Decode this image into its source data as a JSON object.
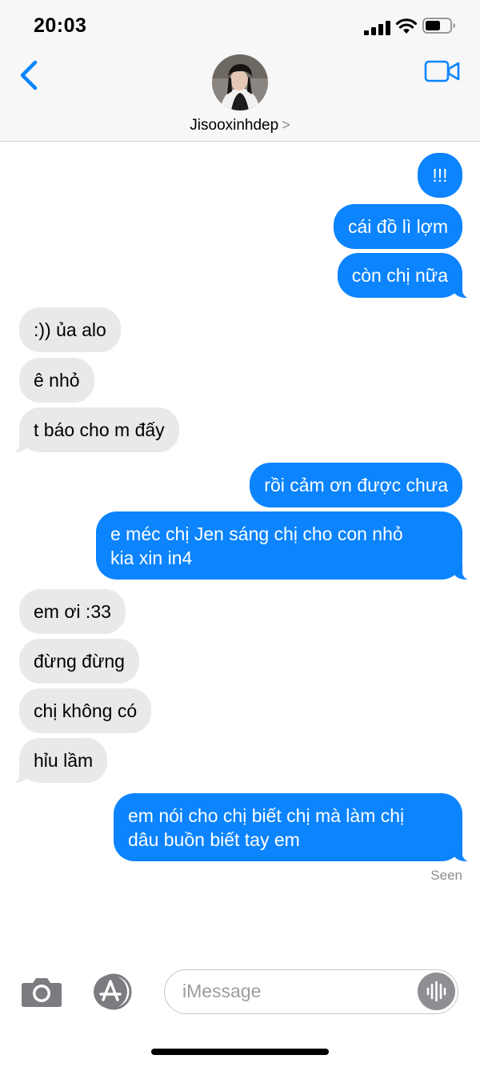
{
  "status": {
    "time": "20:03"
  },
  "header": {
    "contact_name": "Jisooxinhdep",
    "chevron": ">"
  },
  "messages": [
    {
      "dir": "out",
      "text": "!!!"
    },
    {
      "dir": "out",
      "text": "cái đồ lì lợm"
    },
    {
      "dir": "out",
      "text": "còn chị nữa"
    },
    {
      "dir": "in",
      "text": ":)) ủa alo"
    },
    {
      "dir": "in",
      "text": "ê nhỏ"
    },
    {
      "dir": "in",
      "text": "t báo cho m đấy"
    },
    {
      "dir": "out",
      "text": "rồi cảm ơn được chưa"
    },
    {
      "dir": "out",
      "text_lines": [
        "e méc chị Jen sáng chị cho con nhỏ",
        "kia xin in4"
      ]
    },
    {
      "dir": "in",
      "text": "em ơi :33"
    },
    {
      "dir": "in",
      "text": "đừng đừng"
    },
    {
      "dir": "in",
      "text": "chị không có"
    },
    {
      "dir": "in",
      "text": "hỉu lầm"
    },
    {
      "dir": "out",
      "text_lines": [
        "em nói cho chị biết chị mà làm chị",
        "dâu buồn biết tay em"
      ]
    }
  ],
  "receipt": "Seen",
  "composer": {
    "placeholder": "iMessage"
  },
  "icons": [
    "back-chevron-icon",
    "video-camera-icon",
    "camera-icon",
    "app-store-icon",
    "audio-waveform-icon",
    "signal-icon",
    "wifi-icon",
    "battery-icon"
  ],
  "colors": {
    "outgoing": "#0b84fe",
    "incoming": "#e9e9eb",
    "accent": "#0a84ff"
  }
}
